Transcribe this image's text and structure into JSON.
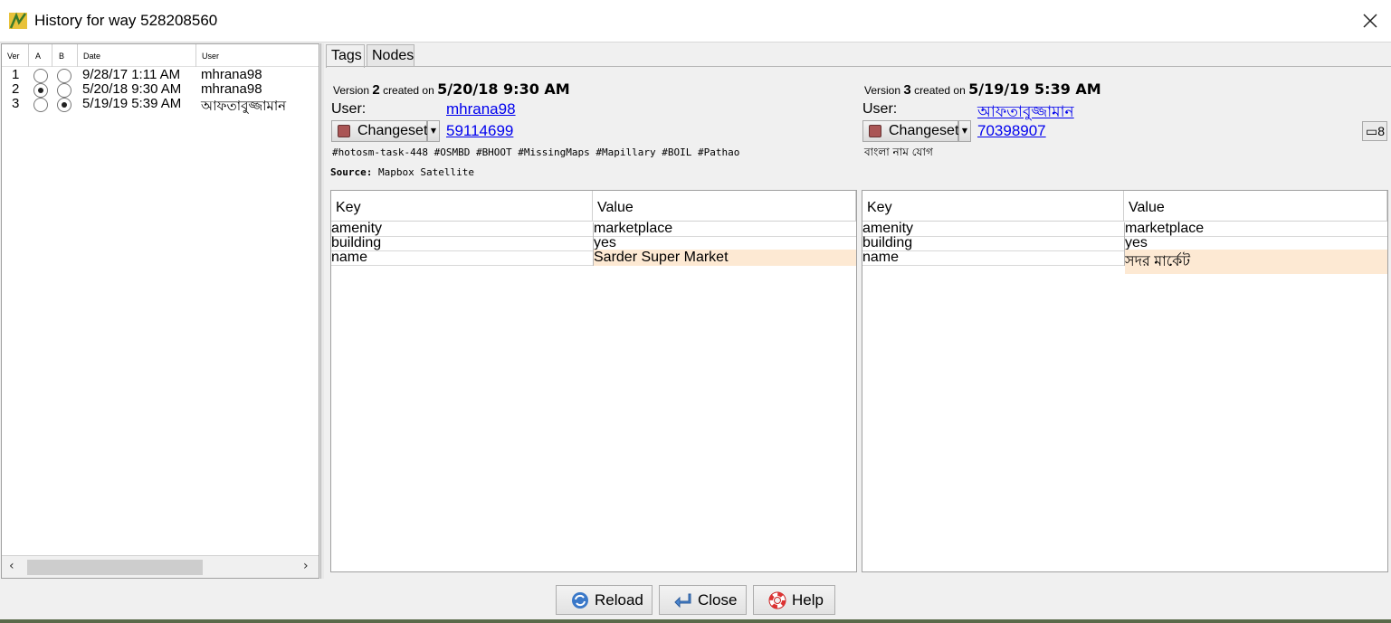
{
  "window": {
    "title": "History for way 528208560"
  },
  "versions": {
    "headers": [
      "Ver",
      "A",
      "B",
      "Date",
      "User"
    ],
    "rows": [
      {
        "ver": "1",
        "date": "9/28/17 1:11 AM",
        "user": "mhrana98",
        "a": false,
        "b": false
      },
      {
        "ver": "2",
        "date": "5/20/18 9:30 AM",
        "user": "mhrana98",
        "a": true,
        "b": false
      },
      {
        "ver": "3",
        "date": "5/19/19 5:39 AM",
        "user": "আফতাবুজ্জামান",
        "a": false,
        "b": true
      }
    ]
  },
  "tabs": [
    {
      "label": "Tags"
    },
    {
      "label": "Nodes"
    }
  ],
  "left_version": {
    "prefix": "Version",
    "number": "2",
    "created_on": "created on",
    "date": "5/20/18 9:30 AM",
    "user_label": "User:",
    "user": "mhrana98",
    "changeset_label": "Changeset",
    "changeset_id": "59114699",
    "comment": "#hotosm-task-448 #OSMBD #BHOOT #MissingMaps #Mapillary #BOIL #Pathao",
    "source_label": "Source:",
    "source": "Mapbox Satellite",
    "columns": [
      "Key",
      "Value"
    ],
    "tags": [
      {
        "key": "amenity",
        "value": "marketplace"
      },
      {
        "key": "building",
        "value": "yes"
      },
      {
        "key": "name",
        "value": "Sarder Super Market"
      }
    ]
  },
  "right_version": {
    "prefix": "Version",
    "number": "3",
    "created_on": "created on",
    "date": "5/19/19 5:39 AM",
    "user_label": "User:",
    "user": "আফতাবুজ্জামান",
    "changeset_label": "Changeset",
    "changeset_id": "70398907",
    "comment": "বাংলা নাম যোগ",
    "comments_count": "8",
    "columns": [
      "Key",
      "Value"
    ],
    "tags": [
      {
        "key": "amenity",
        "value": "marketplace"
      },
      {
        "key": "building",
        "value": "yes"
      },
      {
        "key": "name",
        "value": "সদর মার্কেট"
      }
    ]
  },
  "buttons": {
    "reload": "Reload",
    "close": "Close",
    "help": "Help"
  },
  "colors": {
    "diff_highlight": "#fde9d3",
    "link": "#0000ee"
  },
  "icons": [
    "josm-app-icon",
    "close-icon",
    "changeset-icon",
    "dropdown-arrow-icon",
    "comment-icon",
    "reload-icon",
    "close-arrow-icon",
    "help-lifebuoy-icon"
  ]
}
